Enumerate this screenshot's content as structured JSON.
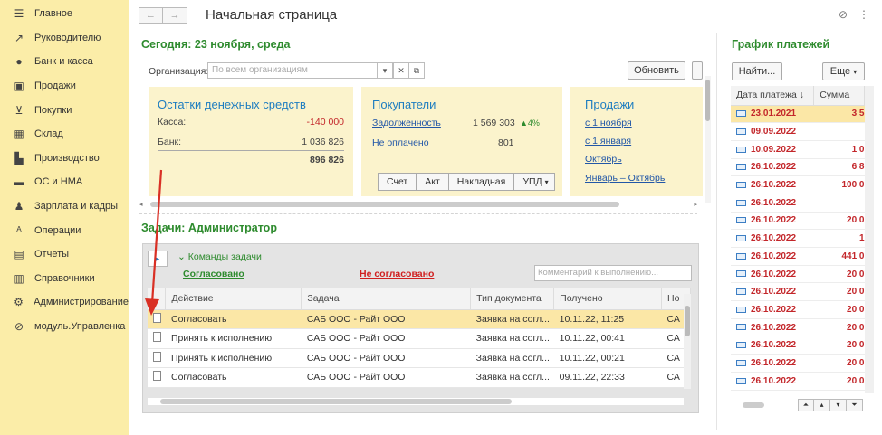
{
  "sidebar": {
    "items": [
      {
        "label": "Главное",
        "icon": "menu-icon",
        "glyph": "☰"
      },
      {
        "label": "Руководителю",
        "icon": "chart-line-icon",
        "glyph": "↗"
      },
      {
        "label": "Банк и касса",
        "icon": "coin-icon",
        "glyph": "●"
      },
      {
        "label": "Продажи",
        "icon": "shopping-bag-icon",
        "glyph": "▣"
      },
      {
        "label": "Покупки",
        "icon": "cart-icon",
        "glyph": "⊻"
      },
      {
        "label": "Склад",
        "icon": "warehouse-icon",
        "glyph": "▦"
      },
      {
        "label": "Производство",
        "icon": "factory-icon",
        "glyph": "▙"
      },
      {
        "label": "ОС и НМА",
        "icon": "truck-icon",
        "glyph": "▬"
      },
      {
        "label": "Зарплата и кадры",
        "icon": "people-icon",
        "glyph": "♟"
      },
      {
        "label": "Операции",
        "icon": "dt-kt-icon",
        "glyph": "ᴬ"
      },
      {
        "label": "Отчеты",
        "icon": "report-icon",
        "glyph": "▤"
      },
      {
        "label": "Справочники",
        "icon": "books-icon",
        "glyph": "▥"
      },
      {
        "label": "Администрирование",
        "icon": "gear-icon",
        "glyph": "⚙"
      },
      {
        "label": "модуль.Управленка",
        "icon": "link-icon",
        "glyph": "⊘"
      }
    ]
  },
  "header": {
    "back": "←",
    "forward": "→",
    "title": "Начальная страница",
    "link_glyph": "🔗",
    "more_glyph": "⋮"
  },
  "today": {
    "title": "Сегодня: 23 ноября, среда",
    "org_label": "Организация:",
    "org_placeholder": "По всем организациям",
    "refresh": "Обновить"
  },
  "cash": {
    "title": "Остатки денежных средств",
    "rows": [
      {
        "label": "Касса:",
        "value": "-140 000"
      },
      {
        "label": "Банк:",
        "value": "1 036 826"
      }
    ],
    "total": "896 826"
  },
  "buyers": {
    "title": "Покупатели",
    "debt_label": "Задолженность",
    "debt_value": "1 569 303",
    "debt_change": "▲4%",
    "unpaid_label": "Не оплачено",
    "unpaid_value": "801",
    "buttons": [
      "Счет",
      "Акт",
      "Накладная",
      "УПД"
    ]
  },
  "sales": {
    "title": "Продажи",
    "links": [
      "с 1 ноября",
      "с 1 января",
      "Октябрь",
      "Январь – Октябрь"
    ]
  },
  "tasks": {
    "title": "Задачи: Администратор",
    "commands": "Команды задачи",
    "approved": "Согласовано",
    "rejected": "Не согласовано",
    "comment_placeholder": "Комментарий к выполнению...",
    "columns": [
      "Действие",
      "Задача",
      "Тип документа",
      "Получено",
      "Но"
    ],
    "rows": [
      {
        "action": "Согласовать",
        "task": "САБ ООО - Райт ООО",
        "doc": "Заявка на согл...",
        "received": "10.11.22, 11:25",
        "extra": "СА"
      },
      {
        "action": "Принять к исполнению",
        "task": "САБ ООО - Райт ООО",
        "doc": "Заявка на согл...",
        "received": "10.11.22, 00:41",
        "extra": "СА"
      },
      {
        "action": "Принять к исполнению",
        "task": "САБ ООО - Райт ООО",
        "doc": "Заявка на согл...",
        "received": "10.11.22, 00:21",
        "extra": "СА"
      },
      {
        "action": "Согласовать",
        "task": "САБ ООО - Райт ООО",
        "doc": "Заявка на согл...",
        "received": "09.11.22, 22:33",
        "extra": "СА"
      }
    ]
  },
  "payments": {
    "title": "График платежей",
    "find": "Найти...",
    "more": "Еще",
    "columns": [
      "Дата платежа",
      "Сумма"
    ],
    "rows": [
      {
        "date": "23.01.2021",
        "sum": "3 5"
      },
      {
        "date": "09.09.2022",
        "sum": ""
      },
      {
        "date": "10.09.2022",
        "sum": "1 0"
      },
      {
        "date": "26.10.2022",
        "sum": "6 8"
      },
      {
        "date": "26.10.2022",
        "sum": "100 0"
      },
      {
        "date": "26.10.2022",
        "sum": ""
      },
      {
        "date": "26.10.2022",
        "sum": "20 0"
      },
      {
        "date": "26.10.2022",
        "sum": "1"
      },
      {
        "date": "26.10.2022",
        "sum": "441 0"
      },
      {
        "date": "26.10.2022",
        "sum": "20 0"
      },
      {
        "date": "26.10.2022",
        "sum": "20 0"
      },
      {
        "date": "26.10.2022",
        "sum": "20 0"
      },
      {
        "date": "26.10.2022",
        "sum": "20 0"
      },
      {
        "date": "26.10.2022",
        "sum": "20 0"
      },
      {
        "date": "26.10.2022",
        "sum": "20 0"
      },
      {
        "date": "26.10.2022",
        "sum": "20 0"
      }
    ]
  },
  "colors": {
    "sidebar_bg": "#fbeda8",
    "section_green": "#2e8b2e",
    "panel_title_blue": "#1e7dc0",
    "arrow_red": "#d93025"
  }
}
